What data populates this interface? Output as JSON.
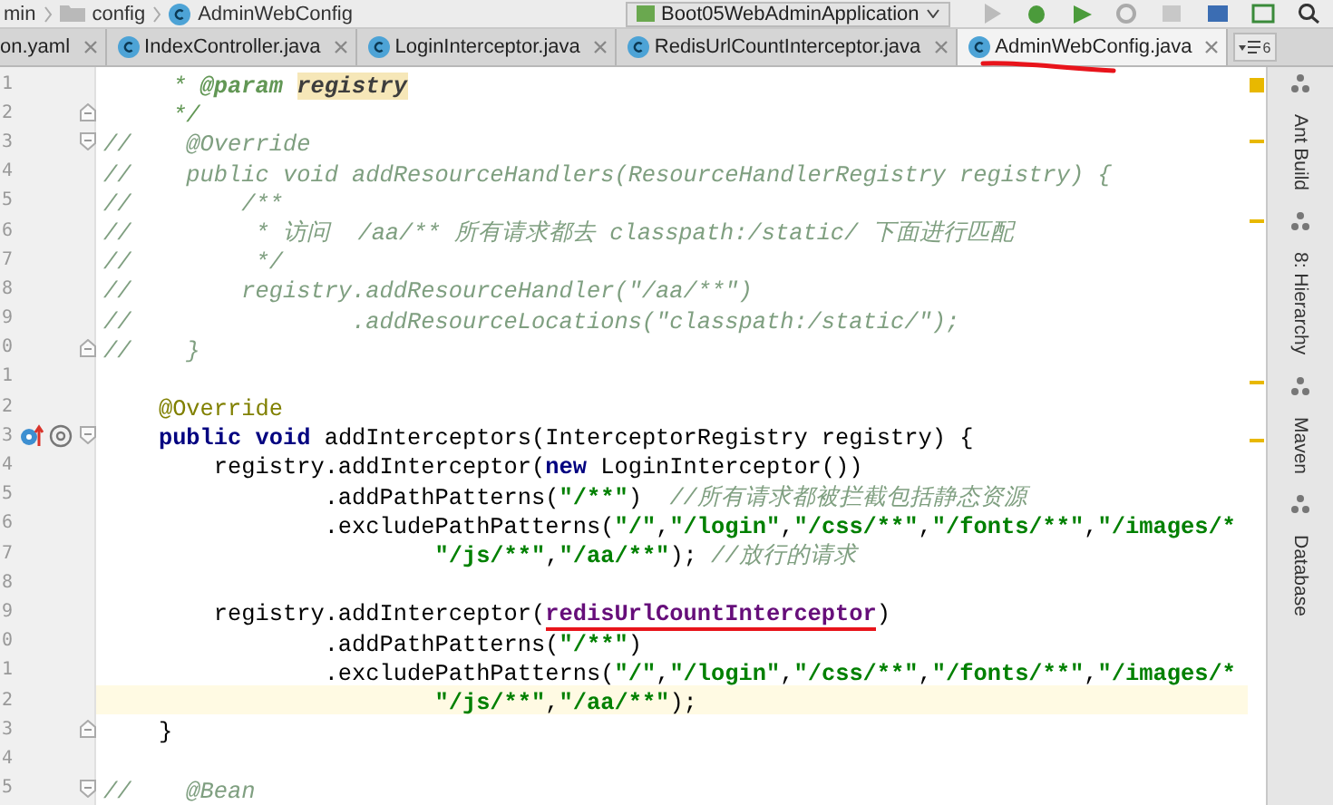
{
  "breadcrumb": [
    "min",
    "config",
    "AdminWebConfig"
  ],
  "run_config": {
    "label": "Boot05WebAdminApplication"
  },
  "tabs": [
    {
      "label": "on.yaml",
      "selected": false
    },
    {
      "label": "IndexController.java",
      "selected": false
    },
    {
      "label": "LoginInterceptor.java",
      "selected": false
    },
    {
      "label": "RedisUrlCountInterceptor.java",
      "selected": false
    },
    {
      "label": "AdminWebConfig.java",
      "selected": true
    }
  ],
  "tab_overflow": {
    "label": "6"
  },
  "editor": {
    "lines": [
      {
        "number": "1",
        "current": false,
        "fold_start": false,
        "fold_end": false,
        "overrides": false,
        "segments": [
          {
            "kind": "doc",
            "text": "     * "
          },
          {
            "kind": "doctag",
            "text": "@param "
          },
          {
            "kind": "docparam",
            "text": "registry"
          }
        ]
      },
      {
        "number": "2",
        "current": false,
        "fold_start": false,
        "fold_end": true,
        "overrides": false,
        "segments": [
          {
            "kind": "doc",
            "text": "     */"
          }
        ]
      },
      {
        "number": "3",
        "current": false,
        "fold_start": true,
        "fold_end": false,
        "overrides": false,
        "segments": [
          {
            "kind": "comment",
            "text": "//    @Override"
          }
        ]
      },
      {
        "number": "4",
        "current": false,
        "fold_start": false,
        "fold_end": false,
        "overrides": false,
        "segments": [
          {
            "kind": "comment",
            "text": "//    public void addResourceHandlers(ResourceHandlerRegistry registry) {"
          }
        ]
      },
      {
        "number": "5",
        "current": false,
        "fold_start": false,
        "fold_end": false,
        "overrides": false,
        "segments": [
          {
            "kind": "comment",
            "text": "//        /**"
          }
        ]
      },
      {
        "number": "6",
        "current": false,
        "fold_start": false,
        "fold_end": false,
        "overrides": false,
        "segments": [
          {
            "kind": "comment",
            "text": "//         * 访问  /aa/** 所有请求都去 classpath:/static/ 下面进行匹配"
          }
        ]
      },
      {
        "number": "7",
        "current": false,
        "fold_start": false,
        "fold_end": false,
        "overrides": false,
        "segments": [
          {
            "kind": "comment",
            "text": "//         */"
          }
        ]
      },
      {
        "number": "8",
        "current": false,
        "fold_start": false,
        "fold_end": false,
        "overrides": false,
        "segments": [
          {
            "kind": "comment",
            "text": "//        registry.addResourceHandler(\"/aa/**\")"
          }
        ]
      },
      {
        "number": "9",
        "current": false,
        "fold_start": false,
        "fold_end": false,
        "overrides": false,
        "segments": [
          {
            "kind": "comment",
            "text": "//                .addResourceLocations(\"classpath:/static/\");"
          }
        ]
      },
      {
        "number": "0",
        "current": false,
        "fold_start": false,
        "fold_end": true,
        "overrides": false,
        "segments": [
          {
            "kind": "comment",
            "text": "//    }"
          }
        ]
      },
      {
        "number": "1",
        "current": false,
        "fold_start": false,
        "fold_end": false,
        "overrides": false
      },
      {
        "number": "2",
        "current": false,
        "fold_start": false,
        "fold_end": false,
        "overrides": false,
        "segments": [
          {
            "kind": "annotation",
            "text": "    @Override"
          }
        ]
      },
      {
        "number": "3",
        "current": false,
        "fold_start": true,
        "fold_end": false,
        "overrides": true,
        "segments": [
          {
            "kind": "keyword",
            "text": "    public void"
          },
          {
            "kind": "plain",
            "text": " addInterceptors(InterceptorRegistry registry) {"
          }
        ]
      },
      {
        "number": "4",
        "current": false,
        "fold_start": false,
        "fold_end": false,
        "overrides": false,
        "segments": [
          {
            "kind": "plain",
            "text": "        registry.addInterceptor("
          },
          {
            "kind": "keyword",
            "text": "new"
          },
          {
            "kind": "plain",
            "text": " LoginInterceptor())"
          }
        ]
      },
      {
        "number": "5",
        "current": false,
        "fold_start": false,
        "fold_end": false,
        "overrides": false,
        "segments": [
          {
            "kind": "plain",
            "text": "                .addPathPatterns("
          },
          {
            "kind": "string",
            "text": "\"/**\""
          },
          {
            "kind": "plain",
            "text": ")"
          },
          {
            "kind": "comment",
            "text": "  //所有请求都被拦截包括静态资源"
          }
        ]
      },
      {
        "number": "6",
        "current": false,
        "fold_start": false,
        "fold_end": false,
        "overrides": false,
        "segments": [
          {
            "kind": "plain",
            "text": "                .excludePathPatterns("
          },
          {
            "kind": "string",
            "text": "\"/\""
          },
          {
            "kind": "plain",
            "text": ","
          },
          {
            "kind": "string",
            "text": "\"/login\""
          },
          {
            "kind": "plain",
            "text": ","
          },
          {
            "kind": "string",
            "text": "\"/css/**\""
          },
          {
            "kind": "plain",
            "text": ","
          },
          {
            "kind": "string",
            "text": "\"/fonts/**\""
          },
          {
            "kind": "plain",
            "text": ","
          },
          {
            "kind": "string",
            "text": "\"/images/*"
          }
        ]
      },
      {
        "number": "7",
        "current": false,
        "fold_start": false,
        "fold_end": false,
        "overrides": false,
        "segments": [
          {
            "kind": "string",
            "text": "                        \"/js/**\""
          },
          {
            "kind": "plain",
            "text": ","
          },
          {
            "kind": "string",
            "text": "\"/aa/**\""
          },
          {
            "kind": "plain",
            "text": ");"
          },
          {
            "kind": "comment",
            "text": " //放行的请求"
          }
        ]
      },
      {
        "number": "8",
        "current": false,
        "fold_start": false,
        "fold_end": false,
        "overrides": false
      },
      {
        "number": "9",
        "current": false,
        "fold_start": false,
        "fold_end": false,
        "overrides": false,
        "segments": [
          {
            "kind": "plain",
            "text": "        registry.addInterceptor("
          },
          {
            "kind": "field",
            "text": "redisUrlCountInterceptor",
            "underlined": true
          },
          {
            "kind": "plain",
            "text": ")"
          }
        ]
      },
      {
        "number": "0",
        "current": false,
        "fold_start": false,
        "fold_end": false,
        "overrides": false,
        "segments": [
          {
            "kind": "plain",
            "text": "                .addPathPatterns("
          },
          {
            "kind": "string",
            "text": "\"/**\""
          },
          {
            "kind": "plain",
            "text": ")"
          }
        ]
      },
      {
        "number": "1",
        "current": false,
        "fold_start": false,
        "fold_end": false,
        "overrides": false,
        "segments": [
          {
            "kind": "plain",
            "text": "                .excludePathPatterns("
          },
          {
            "kind": "string",
            "text": "\"/\""
          },
          {
            "kind": "plain",
            "text": ","
          },
          {
            "kind": "string",
            "text": "\"/login\""
          },
          {
            "kind": "plain",
            "text": ","
          },
          {
            "kind": "string",
            "text": "\"/css/**\""
          },
          {
            "kind": "plain",
            "text": ","
          },
          {
            "kind": "string",
            "text": "\"/fonts/**\""
          },
          {
            "kind": "plain",
            "text": ","
          },
          {
            "kind": "string",
            "text": "\"/images/*"
          }
        ]
      },
      {
        "number": "2",
        "current": true,
        "fold_start": false,
        "fold_end": false,
        "overrides": false,
        "segments": [
          {
            "kind": "string",
            "text": "                        \"/js/**\""
          },
          {
            "kind": "plain",
            "text": ","
          },
          {
            "kind": "string",
            "text": "\"/aa/**\""
          },
          {
            "kind": "plain",
            "text": ");"
          }
        ]
      },
      {
        "number": "3",
        "current": false,
        "fold_start": false,
        "fold_end": true,
        "overrides": false,
        "segments": [
          {
            "kind": "plain",
            "text": "    }"
          }
        ]
      },
      {
        "number": "4",
        "current": false,
        "fold_start": false,
        "fold_end": false,
        "overrides": false
      },
      {
        "number": "5",
        "current": false,
        "fold_start": true,
        "fold_end": false,
        "overrides": false,
        "segments": [
          {
            "kind": "comment",
            "text": "//    @Bean"
          }
        ]
      }
    ]
  },
  "tool_windows": [
    {
      "label": "Ant Build"
    },
    {
      "label": "8: Hierarchy"
    },
    {
      "label": "Maven"
    },
    {
      "label": "Database"
    }
  ]
}
